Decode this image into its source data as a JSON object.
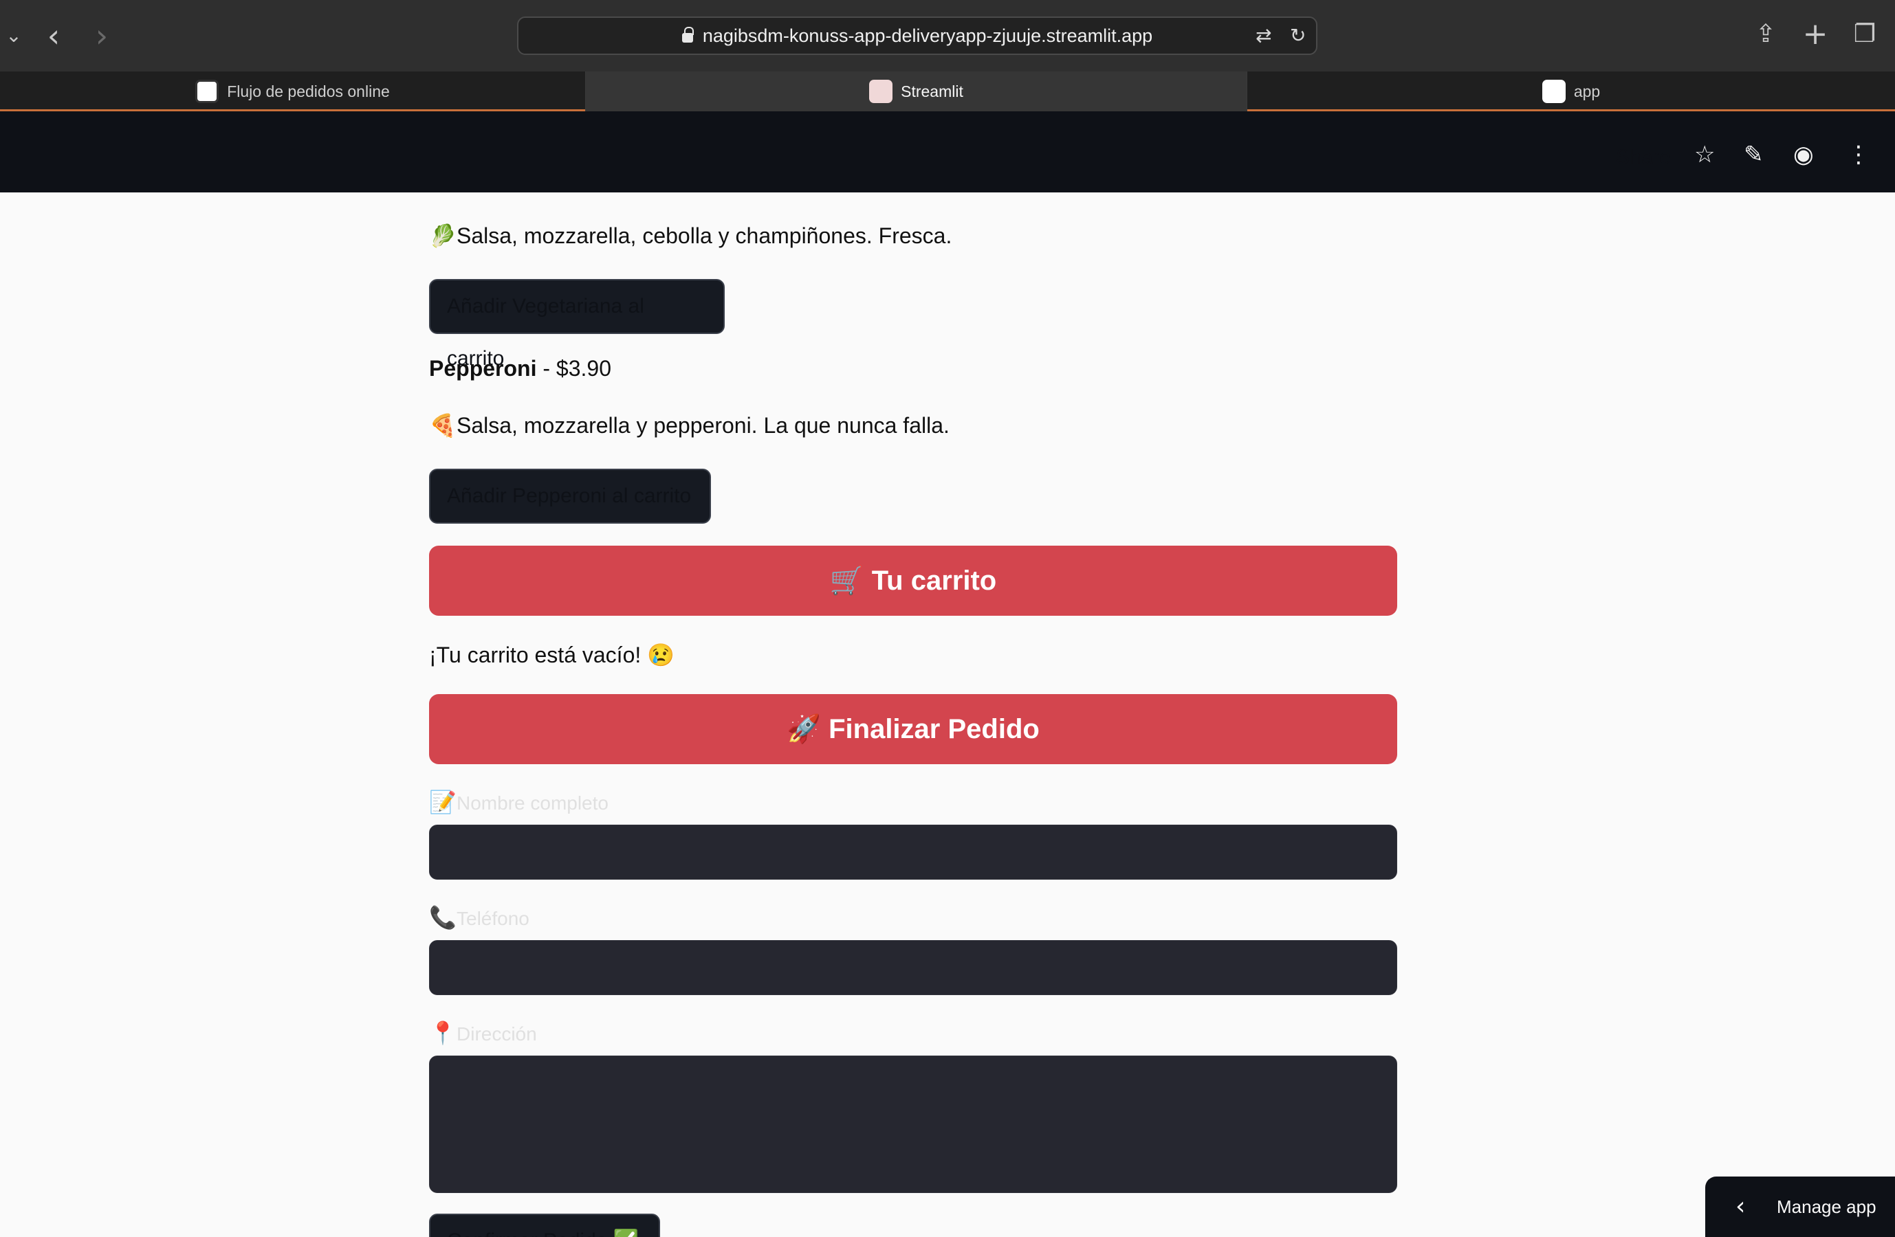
{
  "browser": {
    "url": "nagibsdm-konuss-app-deliveryapp-zjuuje.streamlit.app",
    "tabs": [
      {
        "label": "Flujo de pedidos online"
      },
      {
        "label": "Streamlit"
      },
      {
        "label": "app"
      }
    ]
  },
  "header": {
    "share_label": "Share"
  },
  "menu": {
    "vegetariana": {
      "description": "Salsa, mozzarella, cebolla y champiñones. Fresca.",
      "emoji": "🥬",
      "button_label": "Añadir Vegetariana al carrito"
    },
    "pepperoni": {
      "name": "Pepperoni",
      "price": " - $3.90",
      "emoji": "🍕",
      "description": "Salsa, mozzarella y pepperoni. La que nunca falla.",
      "button_label": "Añadir Pepperoni al carrito"
    }
  },
  "cart": {
    "header": "🛒 Tu carrito",
    "empty_message": "¡Tu carrito está vacío! 😢"
  },
  "checkout": {
    "header": "🚀 Finalizar Pedido",
    "name_label": "Nombre completo",
    "name_emoji": "📝",
    "phone_label": "Teléfono",
    "phone_emoji": "📞",
    "address_label": "Dirección",
    "address_emoji": "📍",
    "confirm_label": "Confirmar Pedido ✅"
  },
  "manage_app": {
    "label": "Manage app"
  }
}
